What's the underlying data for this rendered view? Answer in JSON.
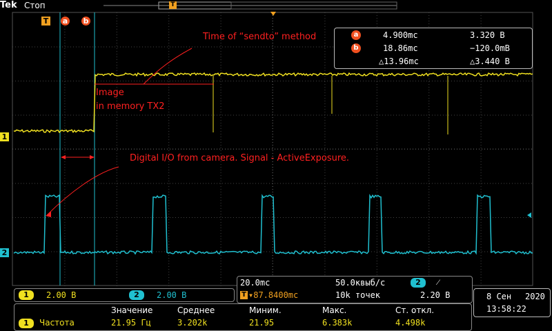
{
  "header": {
    "brand": "Tek",
    "status": "Стоп"
  },
  "markers": {
    "trigger": "T",
    "cursor_a": "a",
    "cursor_b": "b",
    "ch1": "1",
    "ch2": "2"
  },
  "annotations": {
    "time_sendto": "Time of “sendto” method",
    "image_line1": "Image",
    "image_line2": "in memory TX2",
    "digital_io": "Digital I/O from camera. Signal - ActiveExposure."
  },
  "cursor_readout": {
    "a": {
      "label": "a",
      "time": "4.900mc",
      "volt": "3.320 B"
    },
    "b": {
      "label": "b",
      "time": "18.86mc",
      "volt": "−120.0mB"
    },
    "delta": {
      "time": "△13.96mc",
      "volt": "△3.440 B"
    }
  },
  "channels": [
    {
      "id": "1",
      "scale": "2.00 B"
    },
    {
      "id": "2",
      "scale": "2.00 B"
    }
  ],
  "acquisition": {
    "timebase": "20.0mc",
    "sample_rate": "50.0квыб/с",
    "trigger_channel": "2",
    "trigger_slope": "⁄",
    "trigger_position": "▾87.8400mc",
    "record_length": "10k точек",
    "trigger_level": "2.20 B"
  },
  "datetime": {
    "date_day": "8 Сен",
    "year": "2020",
    "time": "13:58:22"
  },
  "measurements": {
    "headers": [
      "Значение",
      "Среднее",
      "Миним.",
      "Макс.",
      "Ст. откл."
    ],
    "row": {
      "channel": "1",
      "name": "Частота",
      "values": [
        "21.95 Гц",
        "3.202k",
        "21.95",
        "6.383k",
        "4.498k"
      ]
    }
  },
  "colors": {
    "ch1": "#f0e020",
    "ch2": "#20c0d0",
    "cursor": "#20c0d0",
    "annotation": "#ff2020",
    "trigger": "#f0a020"
  }
}
